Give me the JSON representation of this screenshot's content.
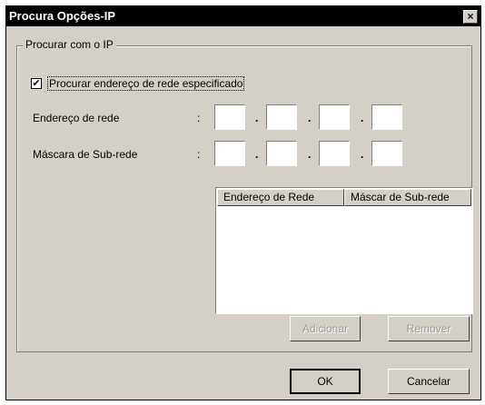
{
  "window": {
    "title": "Procura Opções-IP",
    "close_label": "×"
  },
  "group": {
    "label": "Procurar com o IP"
  },
  "checkbox": {
    "label": "Procurar endereço de rede especificado",
    "checked_mark": "✔"
  },
  "fields": {
    "network_address_label": "Endereço de rede",
    "subnet_mask_label": "Máscara de Sub-rede",
    "colon": ":",
    "separator": "."
  },
  "list": {
    "columns": [
      "Endereço de Rede",
      "Máscar de Sub-rede"
    ],
    "rows": []
  },
  "buttons": {
    "add": "Adicionar",
    "remove": "Remover",
    "ok": "OK",
    "cancel": "Cancelar"
  }
}
